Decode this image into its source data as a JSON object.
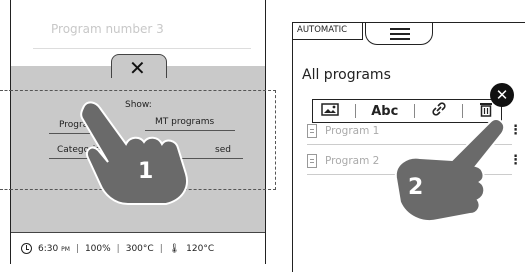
{
  "left_screen": {
    "ghost_title": "Program number 3",
    "close_symbol": "✕",
    "show_label": "Show:",
    "options": {
      "programs": "Progra",
      "mt_programs": "MT programs",
      "categories": "Categories",
      "used": "sed"
    },
    "step_number": "1",
    "status": {
      "time": "6:30",
      "time_suffix": "PM",
      "percent": "100%",
      "temperature": "300°C",
      "probe_temperature": "120°C"
    }
  },
  "right_screen": {
    "mode_tab": "AUTOMATIC",
    "heading": "All programs",
    "toolbar": {
      "text_label": "Abc"
    },
    "close_symbol": "✕",
    "programs": [
      {
        "label": "Program 1"
      },
      {
        "label": "Program 2"
      }
    ],
    "kebab_symbol": "⋮",
    "step_number": "2"
  }
}
